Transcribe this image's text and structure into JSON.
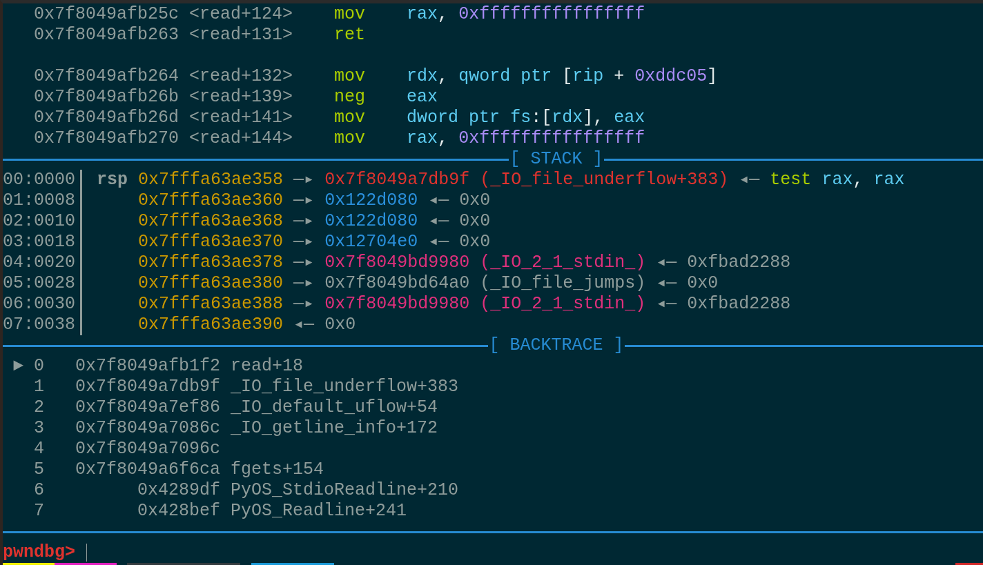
{
  "disassembly": {
    "blocks": [
      [
        {
          "address": "0x7f8049afb25c",
          "symbol": "<read+124>",
          "mnemonic": "mov",
          "operands": [
            {
              "text": "rax",
              "kind": "reg"
            },
            {
              "text": ",",
              "kind": "comma"
            },
            {
              "text": "0xffffffffffffffff",
              "kind": "num"
            }
          ]
        },
        {
          "address": "0x7f8049afb263",
          "symbol": "<read+131>",
          "mnemonic": "ret"
        }
      ],
      [
        {
          "address": "0x7f8049afb264",
          "symbol": "<read+132>",
          "mnemonic": "mov",
          "operands": [
            {
              "text": "rdx",
              "kind": "reg"
            },
            {
              "text": ",",
              "kind": "comma"
            },
            {
              "text": "qword ptr",
              "kind": "size"
            },
            {
              "text": "[",
              "kind": "open"
            },
            {
              "text": "rip",
              "kind": "reg"
            },
            {
              "text": "+",
              "kind": "op"
            },
            {
              "text": "0xddc05",
              "kind": "num"
            },
            {
              "text": "]",
              "kind": "close"
            }
          ]
        },
        {
          "address": "0x7f8049afb26b",
          "symbol": "<read+139>",
          "mnemonic": "neg",
          "operands": [
            {
              "text": "eax",
              "kind": "reg"
            }
          ]
        },
        {
          "address": "0x7f8049afb26d",
          "symbol": "<read+141>",
          "mnemonic": "mov",
          "operands": [
            {
              "text": "dword ptr",
              "kind": "size"
            },
            {
              "text": "fs",
              "kind": "reg"
            },
            {
              "text": ":[",
              "kind": "segopen"
            },
            {
              "text": "rdx",
              "kind": "reg"
            },
            {
              "text": "]",
              "kind": "close"
            },
            {
              "text": ",",
              "kind": "comma"
            },
            {
              "text": "eax",
              "kind": "reg"
            }
          ]
        },
        {
          "address": "0x7f8049afb270",
          "symbol": "<read+144>",
          "mnemonic": "mov",
          "operands": [
            {
              "text": "rax",
              "kind": "reg"
            },
            {
              "text": ",",
              "kind": "comma"
            },
            {
              "text": "0xffffffffffffffff",
              "kind": "num"
            }
          ]
        }
      ]
    ]
  },
  "stack": {
    "title": "[ STACK ]",
    "rows": [
      {
        "offset": "00:0000",
        "register": "rsp",
        "address": "0x7fffa63ae358",
        "chain": [
          {
            "text": "—▸",
            "kind": "arrow"
          },
          {
            "text": "0x7f8049a7db9f (_IO_file_underflow+383)",
            "kind": "code"
          },
          {
            "text": "◂—",
            "kind": "arrow"
          },
          {
            "text": "test",
            "kind": "mnemonic"
          },
          {
            "text": "rax",
            "kind": "reg"
          },
          {
            "text": ",",
            "kind": "comma"
          },
          {
            "text": "rax",
            "kind": "reg"
          }
        ]
      },
      {
        "offset": "01:0008",
        "address": "0x7fffa63ae360",
        "chain": [
          {
            "text": "—▸",
            "kind": "arrow"
          },
          {
            "text": "0x122d080",
            "kind": "heap"
          },
          {
            "text": "◂—",
            "kind": "arrow"
          },
          {
            "text": "0x0",
            "kind": "plain"
          }
        ]
      },
      {
        "offset": "02:0010",
        "address": "0x7fffa63ae368",
        "chain": [
          {
            "text": "—▸",
            "kind": "arrow"
          },
          {
            "text": "0x122d080",
            "kind": "heap"
          },
          {
            "text": "◂—",
            "kind": "arrow"
          },
          {
            "text": "0x0",
            "kind": "plain"
          }
        ]
      },
      {
        "offset": "03:0018",
        "address": "0x7fffa63ae370",
        "chain": [
          {
            "text": "—▸",
            "kind": "arrow"
          },
          {
            "text": "0x12704e0",
            "kind": "heap"
          },
          {
            "text": "◂—",
            "kind": "arrow"
          },
          {
            "text": "0x0",
            "kind": "plain"
          }
        ]
      },
      {
        "offset": "04:0020",
        "address": "0x7fffa63ae378",
        "chain": [
          {
            "text": "—▸",
            "kind": "arrow"
          },
          {
            "text": "0x7f8049bd9980 (_IO_2_1_stdin_)",
            "kind": "data"
          },
          {
            "text": "◂—",
            "kind": "arrow"
          },
          {
            "text": "0xfbad2288",
            "kind": "plain"
          }
        ]
      },
      {
        "offset": "05:0028",
        "address": "0x7fffa63ae380",
        "chain": [
          {
            "text": "—▸",
            "kind": "arrow"
          },
          {
            "text": "0x7f8049bd64a0 (_IO_file_jumps)",
            "kind": "plain"
          },
          {
            "text": "◂—",
            "kind": "arrow"
          },
          {
            "text": "0x0",
            "kind": "plain"
          }
        ]
      },
      {
        "offset": "06:0030",
        "address": "0x7fffa63ae388",
        "chain": [
          {
            "text": "—▸",
            "kind": "arrow"
          },
          {
            "text": "0x7f8049bd9980 (_IO_2_1_stdin_)",
            "kind": "data"
          },
          {
            "text": "◂—",
            "kind": "arrow"
          },
          {
            "text": "0xfbad2288",
            "kind": "plain"
          }
        ]
      },
      {
        "offset": "07:0038",
        "address": "0x7fffa63ae390",
        "chain": [
          {
            "text": "◂—",
            "kind": "arrow"
          },
          {
            "text": "0x0",
            "kind": "plain"
          }
        ]
      }
    ]
  },
  "backtrace": {
    "title": "[ BACKTRACE ]",
    "marker": "►",
    "frames": [
      {
        "number": "0",
        "address": "0x7f8049afb1f2",
        "function": "read+18",
        "selected": true
      },
      {
        "number": "1",
        "address": "0x7f8049a7db9f",
        "function": "_IO_file_underflow+383",
        "selected": false
      },
      {
        "number": "2",
        "address": "0x7f8049a7ef86",
        "function": "_IO_default_uflow+54",
        "selected": false
      },
      {
        "number": "3",
        "address": "0x7f8049a7086c",
        "function": "_IO_getline_info+172",
        "selected": false
      },
      {
        "number": "4",
        "address": "0x7f8049a7096c",
        "selected": false
      },
      {
        "number": "5",
        "address": "0x7f8049a6f6ca",
        "function": "fgets+154",
        "selected": false
      },
      {
        "number": "6",
        "address": "0x4289df",
        "function": "PyOS_StdioReadline+210",
        "selected": false
      },
      {
        "number": "7",
        "address": "0x428bef",
        "function": "PyOS_Readline+241",
        "selected": false
      }
    ]
  },
  "prompt": "pwndbg>",
  "status_segments": [
    {
      "color": "#f0f000"
    },
    {
      "color": "#e020c0"
    },
    {
      "color": "#333b3e"
    },
    {
      "color": "#1a9ad8"
    },
    {
      "color": "#d02828"
    }
  ]
}
